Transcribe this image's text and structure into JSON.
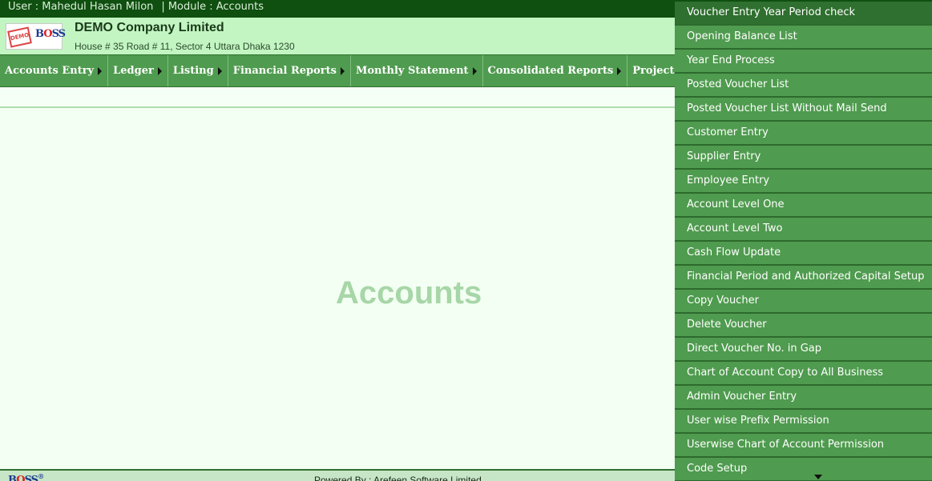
{
  "topbar": {
    "user_text": "User : Mahedul Hasan Milon",
    "separator": "|",
    "module_text": "Module : Accounts"
  },
  "brand": {
    "logo_demo": "DEMO",
    "logo_boss_b": "B",
    "logo_boss_o": "O",
    "logo_boss_ss": "SS",
    "company_name": "DEMO Company Limited",
    "address": "House # 35 Road # 11, Sector 4 Uttara Dhaka 1230"
  },
  "nav": {
    "items": [
      {
        "label": "Accounts Entry"
      },
      {
        "label": "Ledger"
      },
      {
        "label": "Listing"
      },
      {
        "label": "Financial Reports"
      },
      {
        "label": "Monthly Statement"
      },
      {
        "label": "Consolidated Reports"
      },
      {
        "label": "Project Reports"
      }
    ]
  },
  "main": {
    "title": "Accounts"
  },
  "dropdown": {
    "items": [
      {
        "label": "Voucher Entry Year Period check"
      },
      {
        "label": "Opening Balance List"
      },
      {
        "label": "Year End Process"
      },
      {
        "label": "Posted Voucher List"
      },
      {
        "label": "Posted Voucher List Without Mail Send"
      },
      {
        "label": "Customer Entry"
      },
      {
        "label": "Supplier Entry"
      },
      {
        "label": "Employee Entry"
      },
      {
        "label": "Account Level One"
      },
      {
        "label": "Account Level Two"
      },
      {
        "label": "Cash Flow Update"
      },
      {
        "label": "Financial Period and Authorized Capital Setup"
      },
      {
        "label": "Copy Voucher"
      },
      {
        "label": "Delete Voucher"
      },
      {
        "label": "Direct Voucher No. in Gap"
      },
      {
        "label": "Chart of Account Copy to All Business"
      },
      {
        "label": "Admin Voucher Entry"
      },
      {
        "label": "User wise Prefix Permission"
      },
      {
        "label": "Userwise Chart of Account Permission"
      },
      {
        "label": "Code Setup"
      }
    ]
  },
  "footer": {
    "logo_b": "B",
    "logo_o": "O",
    "logo_ss": "SS",
    "logo_reg": "®",
    "powered_text": "Powered By : Arefeen Software Limited"
  },
  "colors": {
    "topbar": "#0f4f0f",
    "brandbar": "#c2f5c2",
    "nav": "#4f9b4f",
    "dropdown_active": "#2f6f2f",
    "main_title": "#a7d6a7"
  }
}
